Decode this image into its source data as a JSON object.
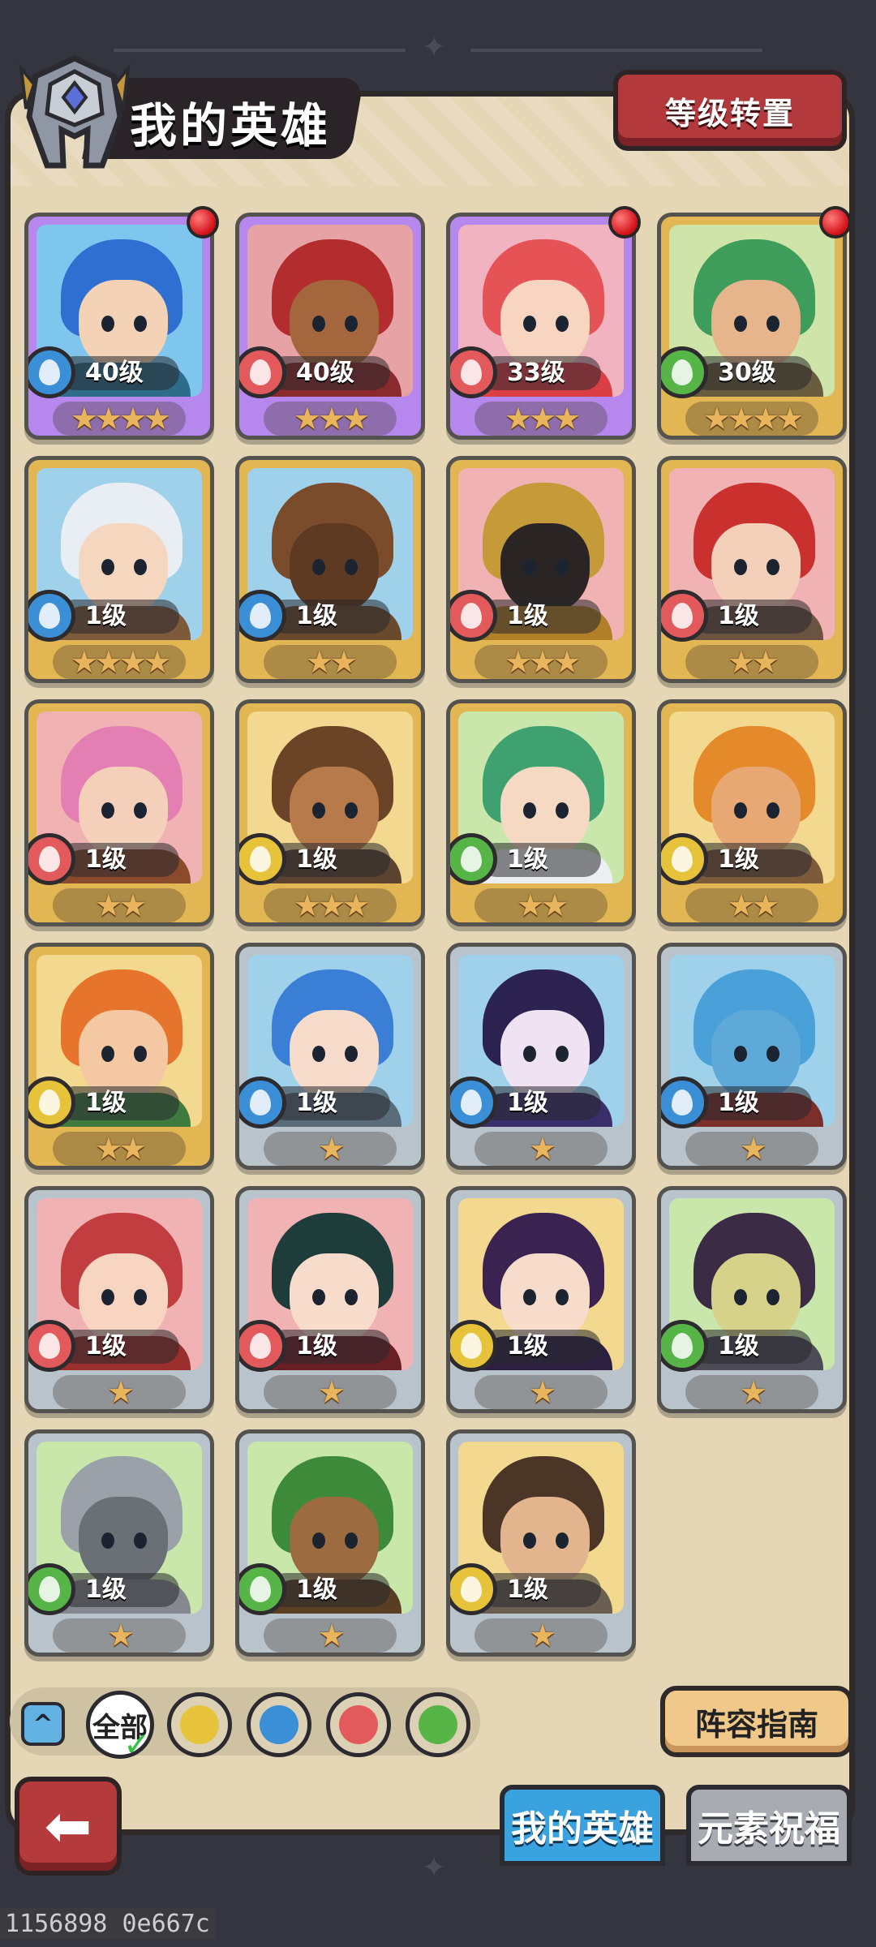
{
  "header": {
    "title": "我的英雄",
    "level_reset_label": "等级转置"
  },
  "heroes": [
    {
      "level": "40级",
      "stars": "★★★★",
      "element": "water",
      "rarity": "purple",
      "red_dot": true,
      "bg": "#7ec6ee",
      "hair": "#2f6fd1",
      "skin": "#f3d2b6",
      "cloth": "#2d6d8a"
    },
    {
      "level": "40级",
      "stars": "★★★",
      "element": "fire",
      "rarity": "purple",
      "red_dot": false,
      "bg": "#e7a2a6",
      "hair": "#b32c2e",
      "skin": "#a4673d",
      "cloth": "#8a2a2c"
    },
    {
      "level": "33级",
      "stars": "★★★",
      "element": "fire",
      "rarity": "purple",
      "red_dot": true,
      "bg": "#f2b3c0",
      "hair": "#e55357",
      "skin": "#f7d5c1",
      "cloth": "#d93f45"
    },
    {
      "level": "30级",
      "stars": "★★★★",
      "element": "wind",
      "rarity": "gold",
      "red_dot": true,
      "bg": "#cfe4a9",
      "hair": "#3f9d5c",
      "skin": "#e7b58c",
      "cloth": "#6a5d3e"
    },
    {
      "level": "1级",
      "stars": "★★★★",
      "element": "water",
      "rarity": "gold",
      "red_dot": false,
      "bg": "#9fd2ea",
      "hair": "#e8eef3",
      "skin": "#f5d6bf",
      "cloth": "#7c5a3a"
    },
    {
      "level": "1级",
      "stars": "★★",
      "element": "water",
      "rarity": "gold",
      "red_dot": false,
      "bg": "#9fd2ea",
      "hair": "#7a4c2c",
      "skin": "#5f3a22",
      "cloth": "#6a4a2c"
    },
    {
      "level": "1级",
      "stars": "★★★",
      "element": "fire",
      "rarity": "gold",
      "red_dot": false,
      "bg": "#f0b2b3",
      "hair": "#c59b39",
      "skin": "#2b2424",
      "cloth": "#b07f27"
    },
    {
      "level": "1级",
      "stars": "★★",
      "element": "fire",
      "rarity": "gold",
      "red_dot": false,
      "bg": "#f0b2b3",
      "hair": "#c9302e",
      "skin": "#f4d0bb",
      "cloth": "#6a5340"
    },
    {
      "level": "1级",
      "stars": "★★",
      "element": "fire",
      "rarity": "gold",
      "red_dot": false,
      "bg": "#f0b2b3",
      "hair": "#e37fb2",
      "skin": "#f4d0bb",
      "cloth": "#8a4b2c"
    },
    {
      "level": "1级",
      "stars": "★★★",
      "element": "earth",
      "rarity": "gold",
      "red_dot": false,
      "bg": "#f3d990",
      "hair": "#6b4326",
      "skin": "#b77a4a",
      "cloth": "#5c4330"
    },
    {
      "level": "1级",
      "stars": "★★",
      "element": "wind",
      "rarity": "gold",
      "red_dot": false,
      "bg": "#c9e7aa",
      "hair": "#3fa070",
      "skin": "#f5d9c3",
      "cloth": "#ebeff2"
    },
    {
      "level": "1级",
      "stars": "★★",
      "element": "earth",
      "rarity": "gold",
      "red_dot": false,
      "bg": "#f3d990",
      "hair": "#e58a2b",
      "skin": "#e8a873",
      "cloth": "#7d5a3a"
    },
    {
      "level": "1级",
      "stars": "★★",
      "element": "earth",
      "rarity": "gold",
      "red_dot": false,
      "bg": "#f3d990",
      "hair": "#e7742c",
      "skin": "#f3c8a2",
      "cloth": "#3f7a3f"
    },
    {
      "level": "1级",
      "stars": "★",
      "element": "water",
      "rarity": "silver",
      "red_dot": false,
      "bg": "#9fd2ea",
      "hair": "#3b7ed6",
      "skin": "#f7dccb",
      "cloth": "#5a6b7a"
    },
    {
      "level": "1级",
      "stars": "★",
      "element": "water",
      "rarity": "silver",
      "red_dot": false,
      "bg": "#9fd2ea",
      "hair": "#2c2250",
      "skin": "#efe3f3",
      "cloth": "#3a2f6a"
    },
    {
      "level": "1级",
      "stars": "★",
      "element": "water",
      "rarity": "silver",
      "red_dot": false,
      "bg": "#9fd2ea",
      "hair": "#4aa0d8",
      "skin": "#5ea9d8",
      "cloth": "#7a2f2a"
    },
    {
      "level": "1级",
      "stars": "★",
      "element": "fire",
      "rarity": "silver",
      "red_dot": false,
      "bg": "#f0b2b3",
      "hair": "#c23d3f",
      "skin": "#f7d5c1",
      "cloth": "#9b2f2c"
    },
    {
      "level": "1级",
      "stars": "★",
      "element": "fire",
      "rarity": "silver",
      "red_dot": false,
      "bg": "#f0b2b3",
      "hair": "#1d3c3a",
      "skin": "#f7dccb",
      "cloth": "#6a1f24"
    },
    {
      "level": "1级",
      "stars": "★",
      "element": "earth",
      "rarity": "silver",
      "red_dot": false,
      "bg": "#f3d990",
      "hair": "#3a2351",
      "skin": "#f7dccb",
      "cloth": "#2c2040"
    },
    {
      "level": "1级",
      "stars": "★",
      "element": "wind",
      "rarity": "silver",
      "red_dot": false,
      "bg": "#c9e7aa",
      "hair": "#3b2b44",
      "skin": "#d6d289",
      "cloth": "#4d4b55"
    },
    {
      "level": "1级",
      "stars": "★",
      "element": "wind",
      "rarity": "silver",
      "red_dot": false,
      "bg": "#c9e7aa",
      "hair": "#9aa1a8",
      "skin": "#6b7076",
      "cloth": "#85898f"
    },
    {
      "level": "1级",
      "stars": "★",
      "element": "wind",
      "rarity": "silver",
      "red_dot": false,
      "bg": "#c9e7aa",
      "hair": "#3c8a3a",
      "skin": "#9c6b3f",
      "cloth": "#5a3e24"
    },
    {
      "level": "1级",
      "stars": "★",
      "element": "earth",
      "rarity": "silver",
      "red_dot": false,
      "bg": "#f3d990",
      "hair": "#4a3527",
      "skin": "#e2b58e",
      "cloth": "#6b5f52"
    }
  ],
  "filters": {
    "all_label": "全部",
    "elements": [
      "earth",
      "water",
      "fire",
      "wind"
    ]
  },
  "buttons": {
    "guide_label": "阵容指南"
  },
  "tabs": [
    {
      "label": "我的英雄",
      "active": true
    },
    {
      "label": "元素祝福",
      "active": false
    }
  ],
  "footer_code": "1156898 0e667c",
  "colors": {
    "water": "#3b8fd6",
    "fire": "#e25a5c",
    "wind": "#57b548",
    "earth": "#e6c33a"
  }
}
